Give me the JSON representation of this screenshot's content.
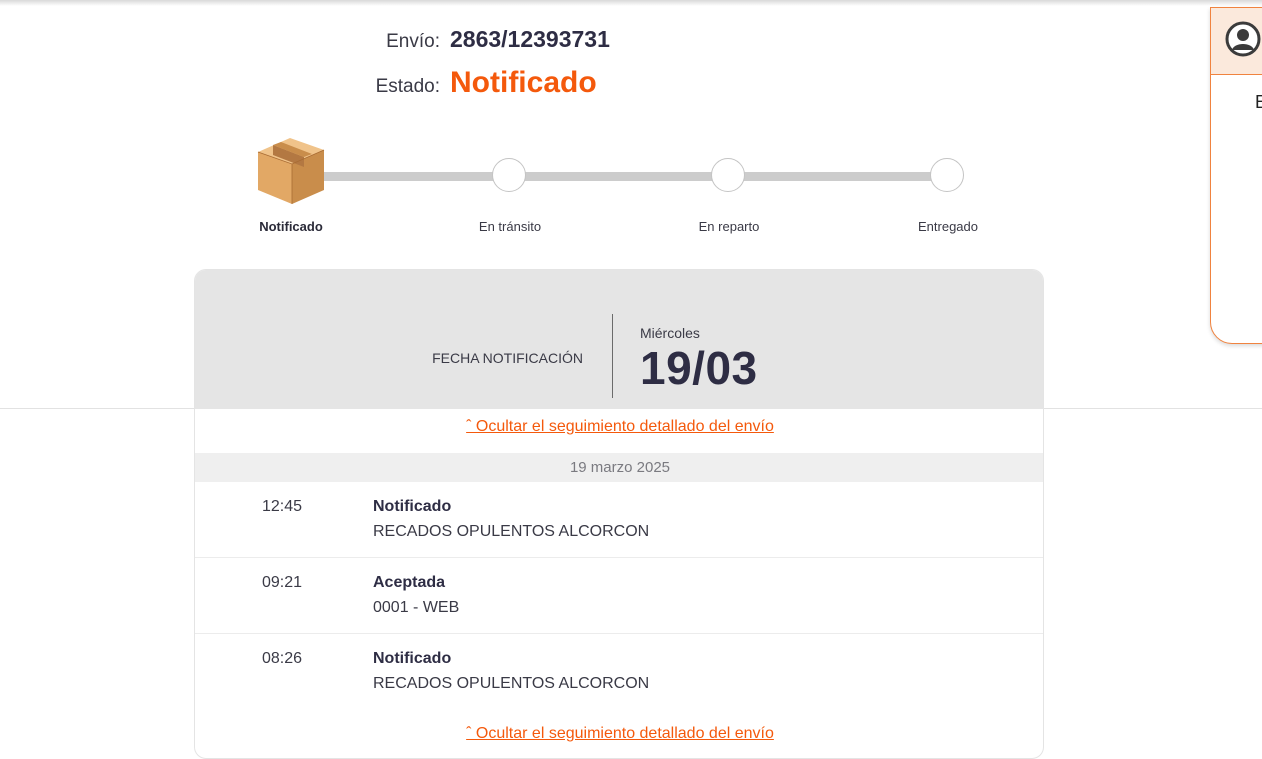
{
  "shipment": {
    "envio_label": "Envío:",
    "envio_value": "2863/12393731",
    "estado_label": "Estado:",
    "estado_value": "Notificado"
  },
  "steps": [
    {
      "label": "Notificado",
      "active": true,
      "icon": "package-box-icon"
    },
    {
      "label": "En tránsito",
      "active": false
    },
    {
      "label": "En reparto",
      "active": false
    },
    {
      "label": "Entregado",
      "active": false
    }
  ],
  "card": {
    "fecha_label": "FECHA NOTIFICACIÓN",
    "day_name": "Miércoles",
    "date": "19/03",
    "toggle_label": "ˆ Ocultar el seguimiento detallado del envío",
    "group_date": "19 marzo 2025",
    "events": [
      {
        "time": "12:45",
        "title": "Notificado",
        "location": "RECADOS OPULENTOS ALCORCON"
      },
      {
        "time": "09:21",
        "title": "Aceptada",
        "location": "0001 - WEB"
      },
      {
        "time": "08:26",
        "title": "Notificado",
        "location": "RECADOS OPULENTOS ALCORCON"
      }
    ]
  },
  "side_panel": {
    "icon": "user-avatar-icon",
    "partial_text": "E"
  },
  "colors": {
    "accent": "#f4590c",
    "dark_text": "#2e2d44",
    "track": "#cccccc",
    "card_header": "#e5e5e5"
  }
}
